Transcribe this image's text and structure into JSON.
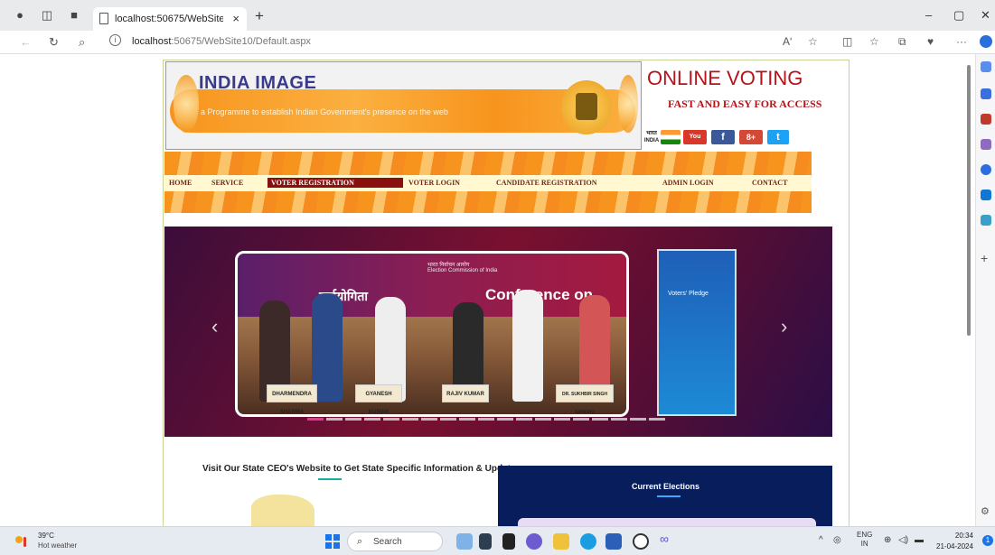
{
  "browser": {
    "tab_title": "localhost:50675/WebSite10/Defa",
    "tab_close": "×",
    "new_tab": "+",
    "url_host": "localhost",
    "url_path": ":50675/WebSite10/Default.aspx",
    "window_controls": [
      "–",
      "▢",
      "✕"
    ],
    "toolbar_icons": [
      "read-aloud-icon",
      "favorite-star-icon",
      "split-screen-icon",
      "favorites-icon",
      "collections-icon",
      "extensions-icon",
      "more-icon",
      "copilot-icon"
    ],
    "more_label": "···",
    "read_aloud_label": "Aʹ",
    "sidebar_plus": "+"
  },
  "site": {
    "banner_title": "INDIA IMAGE",
    "banner_subtitle": "a Programme to establish Indian Government's presence on the web",
    "online_voting_title": "ONLINE VOTING",
    "online_voting_sub": "FAST AND EASY FOR ACCESS",
    "social": [
      "भारत INDIA",
      "You Tube",
      "f",
      "8+",
      "t"
    ],
    "nav": [
      {
        "label": "HOME",
        "active": false
      },
      {
        "label": "SERVICE",
        "active": false
      },
      {
        "label": "VOTER REGISTRATION",
        "active": true
      },
      {
        "label": "VOTER LOGIN",
        "active": false
      },
      {
        "label": "CANDIDATE REGISTRATION",
        "active": false
      },
      {
        "label": "ADMIN LOGIN",
        "active": false
      },
      {
        "label": "CONTACT",
        "active": false
      }
    ],
    "carousel": {
      "slide_heading_hindi": "कर्मयोगिता",
      "slide_heading_en": "Conference on",
      "slide_org_hindi": "भारत निर्वाचन आयोग",
      "slide_org_en": "Election Commission of India",
      "nameplates": [
        "DHARMENDRA SHARMA",
        "GYANESH KUMAR",
        "RAJIV KUMAR",
        "DR. SUKHBIR SINGH SANDHU"
      ],
      "book_title": "Voters' Pledge",
      "prev_arrow": "‹",
      "next_arrow": "›",
      "indicator_count": 19,
      "active_indicator": 0
    },
    "visit_heading": "Visit Our State CEO's Website to Get State Specific Information & Updates",
    "current_elections": "Current Elections"
  },
  "taskbar": {
    "weather_temp": "39°C",
    "weather_desc": "Hot weather",
    "search_label": "Search",
    "lang_top": "ENG",
    "lang_bottom": "IN",
    "time": "20:34",
    "date": "21-04-2024",
    "chevron": "^"
  },
  "colors": {
    "accent_red": "#b3141b",
    "nav_active": "#8a0f0f",
    "orange": "#f7941d",
    "elections_blue": "#071d5c"
  }
}
